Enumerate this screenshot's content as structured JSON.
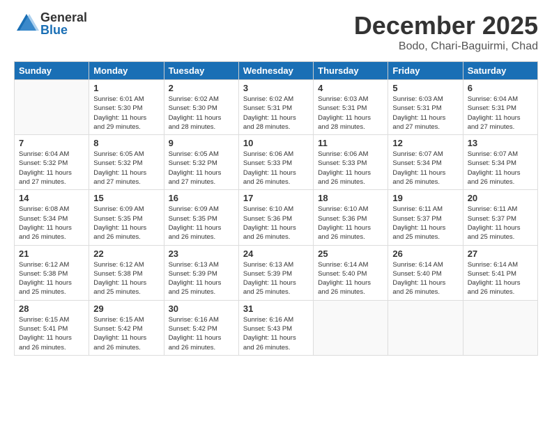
{
  "header": {
    "logo_general": "General",
    "logo_blue": "Blue",
    "title": "December 2025",
    "subtitle": "Bodo, Chari-Baguirmi, Chad"
  },
  "calendar": {
    "days_of_week": [
      "Sunday",
      "Monday",
      "Tuesday",
      "Wednesday",
      "Thursday",
      "Friday",
      "Saturday"
    ],
    "weeks": [
      [
        {
          "day": "",
          "sunrise": "",
          "sunset": "",
          "daylight": ""
        },
        {
          "day": "1",
          "sunrise": "Sunrise: 6:01 AM",
          "sunset": "Sunset: 5:30 PM",
          "daylight": "Daylight: 11 hours and 29 minutes."
        },
        {
          "day": "2",
          "sunrise": "Sunrise: 6:02 AM",
          "sunset": "Sunset: 5:30 PM",
          "daylight": "Daylight: 11 hours and 28 minutes."
        },
        {
          "day": "3",
          "sunrise": "Sunrise: 6:02 AM",
          "sunset": "Sunset: 5:31 PM",
          "daylight": "Daylight: 11 hours and 28 minutes."
        },
        {
          "day": "4",
          "sunrise": "Sunrise: 6:03 AM",
          "sunset": "Sunset: 5:31 PM",
          "daylight": "Daylight: 11 hours and 28 minutes."
        },
        {
          "day": "5",
          "sunrise": "Sunrise: 6:03 AM",
          "sunset": "Sunset: 5:31 PM",
          "daylight": "Daylight: 11 hours and 27 minutes."
        },
        {
          "day": "6",
          "sunrise": "Sunrise: 6:04 AM",
          "sunset": "Sunset: 5:31 PM",
          "daylight": "Daylight: 11 hours and 27 minutes."
        }
      ],
      [
        {
          "day": "7",
          "sunrise": "Sunrise: 6:04 AM",
          "sunset": "Sunset: 5:32 PM",
          "daylight": "Daylight: 11 hours and 27 minutes."
        },
        {
          "day": "8",
          "sunrise": "Sunrise: 6:05 AM",
          "sunset": "Sunset: 5:32 PM",
          "daylight": "Daylight: 11 hours and 27 minutes."
        },
        {
          "day": "9",
          "sunrise": "Sunrise: 6:05 AM",
          "sunset": "Sunset: 5:32 PM",
          "daylight": "Daylight: 11 hours and 27 minutes."
        },
        {
          "day": "10",
          "sunrise": "Sunrise: 6:06 AM",
          "sunset": "Sunset: 5:33 PM",
          "daylight": "Daylight: 11 hours and 26 minutes."
        },
        {
          "day": "11",
          "sunrise": "Sunrise: 6:06 AM",
          "sunset": "Sunset: 5:33 PM",
          "daylight": "Daylight: 11 hours and 26 minutes."
        },
        {
          "day": "12",
          "sunrise": "Sunrise: 6:07 AM",
          "sunset": "Sunset: 5:34 PM",
          "daylight": "Daylight: 11 hours and 26 minutes."
        },
        {
          "day": "13",
          "sunrise": "Sunrise: 6:07 AM",
          "sunset": "Sunset: 5:34 PM",
          "daylight": "Daylight: 11 hours and 26 minutes."
        }
      ],
      [
        {
          "day": "14",
          "sunrise": "Sunrise: 6:08 AM",
          "sunset": "Sunset: 5:34 PM",
          "daylight": "Daylight: 11 hours and 26 minutes."
        },
        {
          "day": "15",
          "sunrise": "Sunrise: 6:09 AM",
          "sunset": "Sunset: 5:35 PM",
          "daylight": "Daylight: 11 hours and 26 minutes."
        },
        {
          "day": "16",
          "sunrise": "Sunrise: 6:09 AM",
          "sunset": "Sunset: 5:35 PM",
          "daylight": "Daylight: 11 hours and 26 minutes."
        },
        {
          "day": "17",
          "sunrise": "Sunrise: 6:10 AM",
          "sunset": "Sunset: 5:36 PM",
          "daylight": "Daylight: 11 hours and 26 minutes."
        },
        {
          "day": "18",
          "sunrise": "Sunrise: 6:10 AM",
          "sunset": "Sunset: 5:36 PM",
          "daylight": "Daylight: 11 hours and 26 minutes."
        },
        {
          "day": "19",
          "sunrise": "Sunrise: 6:11 AM",
          "sunset": "Sunset: 5:37 PM",
          "daylight": "Daylight: 11 hours and 25 minutes."
        },
        {
          "day": "20",
          "sunrise": "Sunrise: 6:11 AM",
          "sunset": "Sunset: 5:37 PM",
          "daylight": "Daylight: 11 hours and 25 minutes."
        }
      ],
      [
        {
          "day": "21",
          "sunrise": "Sunrise: 6:12 AM",
          "sunset": "Sunset: 5:38 PM",
          "daylight": "Daylight: 11 hours and 25 minutes."
        },
        {
          "day": "22",
          "sunrise": "Sunrise: 6:12 AM",
          "sunset": "Sunset: 5:38 PM",
          "daylight": "Daylight: 11 hours and 25 minutes."
        },
        {
          "day": "23",
          "sunrise": "Sunrise: 6:13 AM",
          "sunset": "Sunset: 5:39 PM",
          "daylight": "Daylight: 11 hours and 25 minutes."
        },
        {
          "day": "24",
          "sunrise": "Sunrise: 6:13 AM",
          "sunset": "Sunset: 5:39 PM",
          "daylight": "Daylight: 11 hours and 25 minutes."
        },
        {
          "day": "25",
          "sunrise": "Sunrise: 6:14 AM",
          "sunset": "Sunset: 5:40 PM",
          "daylight": "Daylight: 11 hours and 26 minutes."
        },
        {
          "day": "26",
          "sunrise": "Sunrise: 6:14 AM",
          "sunset": "Sunset: 5:40 PM",
          "daylight": "Daylight: 11 hours and 26 minutes."
        },
        {
          "day": "27",
          "sunrise": "Sunrise: 6:14 AM",
          "sunset": "Sunset: 5:41 PM",
          "daylight": "Daylight: 11 hours and 26 minutes."
        }
      ],
      [
        {
          "day": "28",
          "sunrise": "Sunrise: 6:15 AM",
          "sunset": "Sunset: 5:41 PM",
          "daylight": "Daylight: 11 hours and 26 minutes."
        },
        {
          "day": "29",
          "sunrise": "Sunrise: 6:15 AM",
          "sunset": "Sunset: 5:42 PM",
          "daylight": "Daylight: 11 hours and 26 minutes."
        },
        {
          "day": "30",
          "sunrise": "Sunrise: 6:16 AM",
          "sunset": "Sunset: 5:42 PM",
          "daylight": "Daylight: 11 hours and 26 minutes."
        },
        {
          "day": "31",
          "sunrise": "Sunrise: 6:16 AM",
          "sunset": "Sunset: 5:43 PM",
          "daylight": "Daylight: 11 hours and 26 minutes."
        },
        {
          "day": "",
          "sunrise": "",
          "sunset": "",
          "daylight": ""
        },
        {
          "day": "",
          "sunrise": "",
          "sunset": "",
          "daylight": ""
        },
        {
          "day": "",
          "sunrise": "",
          "sunset": "",
          "daylight": ""
        }
      ]
    ]
  }
}
